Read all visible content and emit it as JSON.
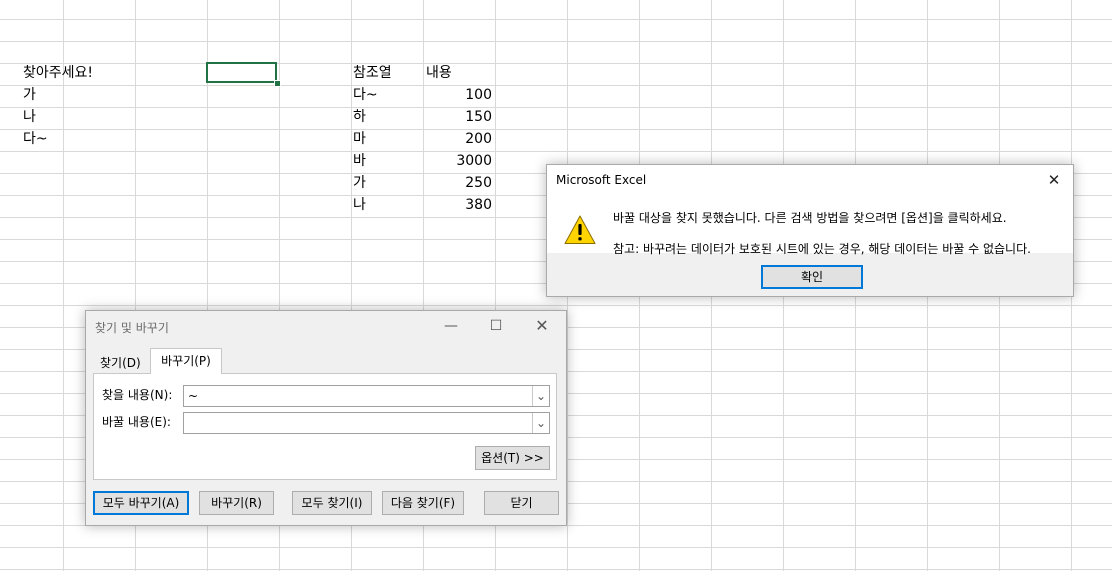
{
  "sheet": {
    "cells": [
      {
        "text": "찾아주세요!"
      },
      {
        "text": "가"
      },
      {
        "text": "나"
      },
      {
        "text": "다~"
      },
      {
        "text": "참조열"
      },
      {
        "text": "내용"
      },
      {
        "text": "다~"
      },
      {
        "text": "100"
      },
      {
        "text": "하"
      },
      {
        "text": "150"
      },
      {
        "text": "마"
      },
      {
        "text": "200"
      },
      {
        "text": "바"
      },
      {
        "text": "3000"
      },
      {
        "text": "가"
      },
      {
        "text": "250"
      },
      {
        "text": "나"
      },
      {
        "text": "380"
      }
    ],
    "accent": "#217346"
  },
  "find_dialog": {
    "title": "찾기 및 바꾸기",
    "tabs": [
      "찾기(D)",
      "바꾸기(P)"
    ],
    "active_tab": "바꾸기(P)",
    "find_label": "찾을 내용(N):",
    "find_value": "~",
    "replace_label": "바꿀 내용(E):",
    "replace_value": "",
    "options_button": "옵션(T) >>",
    "buttons": {
      "replace_all": "모두 바꾸기(A)",
      "replace": "바꾸기(R)",
      "find_all": "모두 찾기(I)",
      "find_next": "다음 찾기(F)",
      "close": "닫기"
    }
  },
  "message_box": {
    "title": "Microsoft Excel",
    "line1": "바꿀 대상을 찾지 못했습니다. 다른 검색 방법을 찾으려면 [옵션]을 클릭하세요.",
    "line2": "참고: 바꾸려는 데이터가 보호된 시트에 있는 경우, 해당 데이터는 바꿀 수 없습니다.",
    "ok_label": "확인",
    "icon": "warning-icon",
    "button_accent": "#0078d7"
  }
}
